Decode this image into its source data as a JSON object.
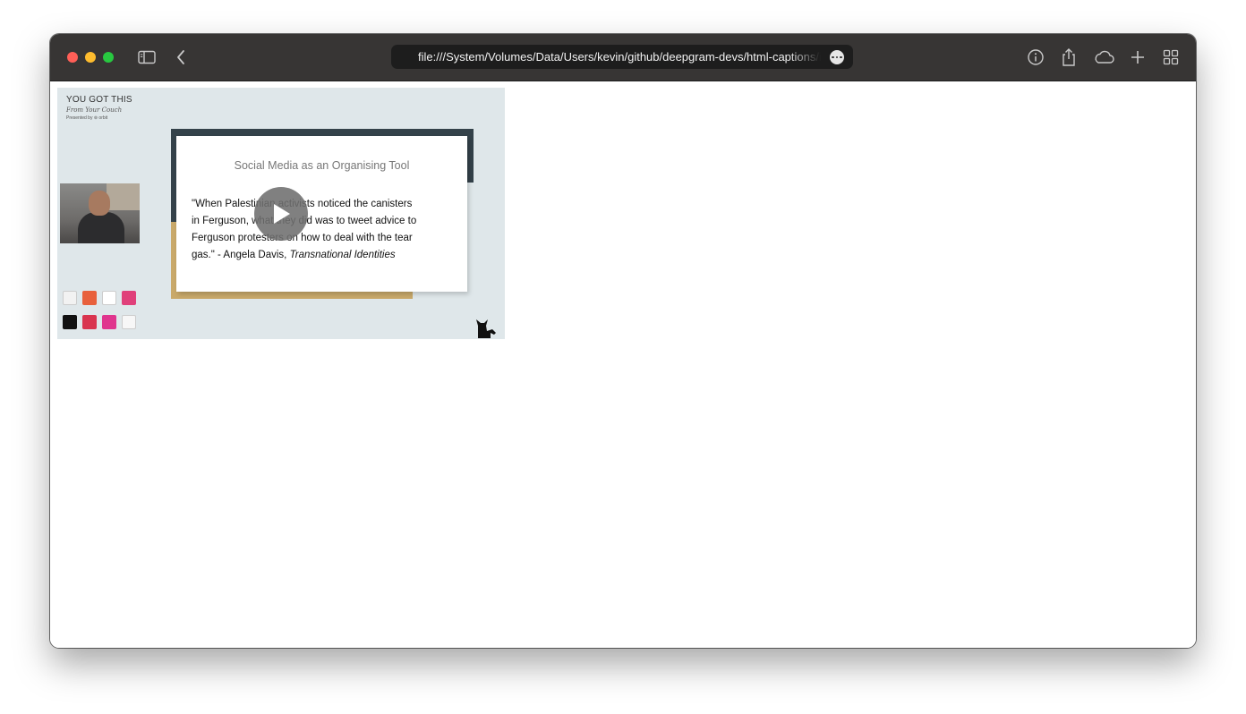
{
  "browser": {
    "url": "file:///System/Volumes/Data/Users/kevin/github/deepgram-devs/html-captions/index.html"
  },
  "video": {
    "brand_title": "YOU GOT THIS",
    "brand_subtitle": "From Your Couch",
    "brand_small": "Presented by ⊚ orbit",
    "slide_title": "Social Media as an Organising Tool",
    "quote_line1": "\"When Palestinian activists noticed the canisters",
    "quote_line2": "in Ferguson, what they did was to tweet advice to",
    "quote_line3": "Ferguson protesters on how to deal with the tear",
    "quote_line4_prefix": "gas.\" - Angela Davis, ",
    "quote_source": "Transnational Identities"
  },
  "icons": {
    "sidebar": "sidebar-icon",
    "back": "chevron-left-icon",
    "info": "info-icon",
    "share": "share-icon",
    "cloud": "cloud-icon",
    "new_tab": "plus-icon",
    "tabs": "tab-overview-icon",
    "play": "play-icon"
  },
  "colors": {
    "toolbar": "#373534",
    "address_bar": "#1d1d1d",
    "close": "#ff5f57",
    "minimize": "#febc2e",
    "maximize": "#28c840"
  }
}
